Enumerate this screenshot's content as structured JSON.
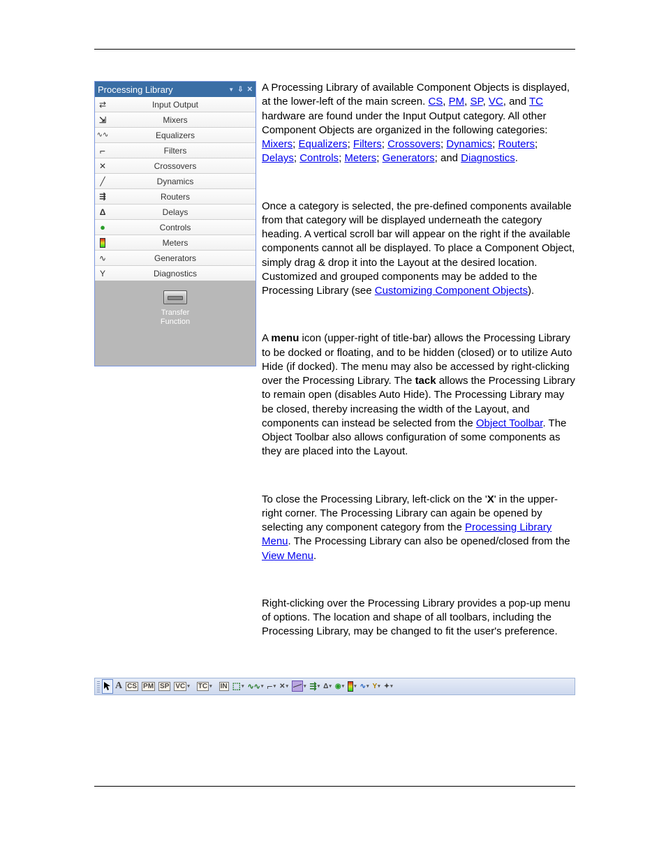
{
  "panel": {
    "title": "Processing Library",
    "categories": [
      {
        "label": "Input Output",
        "icon": "io"
      },
      {
        "label": "Mixers",
        "icon": "mixers"
      },
      {
        "label": "Equalizers",
        "icon": "eq"
      },
      {
        "label": "Filters",
        "icon": "filters"
      },
      {
        "label": "Crossovers",
        "icon": "xover"
      },
      {
        "label": "Dynamics",
        "icon": "dyn"
      },
      {
        "label": "Routers",
        "icon": "routers"
      },
      {
        "label": "Delays",
        "icon": "delays"
      },
      {
        "label": "Controls",
        "icon": "controls"
      },
      {
        "label": "Meters",
        "icon": "meters"
      },
      {
        "label": "Generators",
        "icon": "gen"
      },
      {
        "label": "Diagnostics",
        "icon": "diag"
      }
    ],
    "item_label_1": "Transfer",
    "item_label_2": "Function"
  },
  "para1": {
    "t1": "A Processing Library of available Component Objects is displayed, at the lower-left of the main screen. ",
    "cs": "CS",
    "c1": ", ",
    "pm": "PM",
    "c2": ", ",
    "sp": "SP",
    "c3": ", ",
    "vc": "VC",
    "c4": ", and ",
    "tc": "TC",
    "t2": " hardware are found under the Input Output category. All other Component Objects are organized in the following categories: ",
    "mixers": "Mixers",
    "s1": "; ",
    "equalizers": "Equalizers",
    "s2": "; ",
    "filters": "Filters",
    "s3": "; ",
    "crossovers": "Crossovers",
    "s4": "; ",
    "dynamics": "Dynamics",
    "s5": "; ",
    "routers": "Routers",
    "s6": "; ",
    "delays": "Delays",
    "s7": "; ",
    "controls": "Controls",
    "s8": "; ",
    "meters": "Meters",
    "s9": "; ",
    "generators": "Generators",
    "s10": "; and ",
    "diagnostics": "Diagnostics",
    "s11": "."
  },
  "para2": {
    "t1": "Once a category is selected, the pre-defined components available from that category will be displayed underneath the category heading. A vertical scroll bar will appear on the right if the available components cannot all be displayed. To place a Component Object, simply drag & drop it into the Layout at the desired location. Customized and grouped components may be added to the Processing Library (see ",
    "link": "Customizing Component Objects",
    "t2": ")."
  },
  "para3": {
    "t1a": "A ",
    "menu": "menu",
    "t1b": " icon (upper-right of title-bar) allows the Processing Library to be docked or floating, and to be hidden (closed) or to utilize Auto Hide (if docked). The menu may also be accessed by right-clicking over the Processing Library. The ",
    "tack": "tack",
    "t2": " allows the Processing Library to remain open (disables Auto Hide). The Processing Library may be closed, thereby increasing the width of the Layout, and components can instead be selected from the ",
    "link": "Object Toolbar",
    "t3": ". The Object Toolbar also allows configuration of some components as they are placed into the Layout."
  },
  "para4": {
    "t1": "To close the Processing Library, left-click on the '",
    "x": "X",
    "t2": "' in the upper-right corner. The Processing Library can again be opened by selecting any component category from the ",
    "link1": "Processing Library Menu",
    "t3": ". The Processing Library can also be opened/closed from the ",
    "link2": "View Menu",
    "t4": "."
  },
  "para5": {
    "t1": "Right-clicking over the Processing Library provides a pop-up menu of options. The location and shape of all toolbars, including the Processing Library, may be changed to fit the user's preference."
  },
  "objbar": {
    "items": [
      "CS",
      "PM",
      "SP",
      "VC",
      "TC",
      "IN"
    ]
  }
}
